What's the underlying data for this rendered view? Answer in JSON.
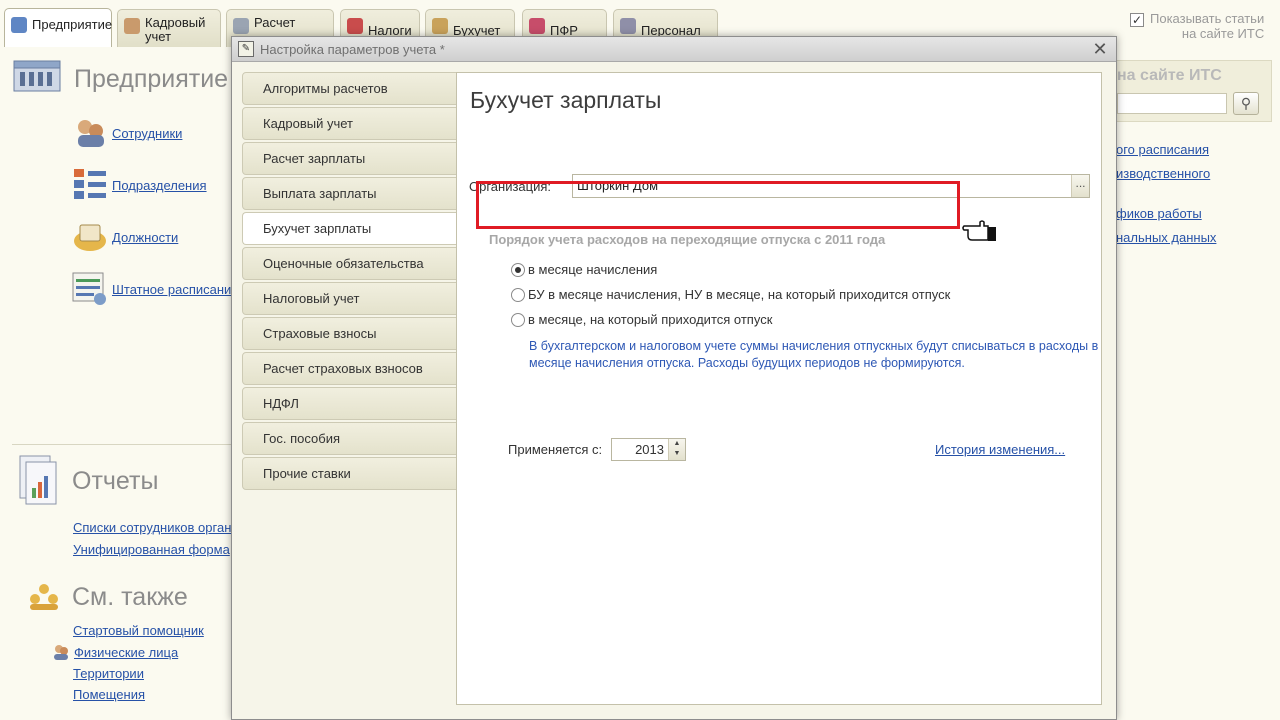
{
  "top_tabs": [
    {
      "label": "Предприятие",
      "icon": "enterprise-icon",
      "active": true
    },
    {
      "label": "Кадровый\nучет",
      "icon": "people-icon",
      "active": false
    },
    {
      "label": "Расчет\n",
      "icon": "calc-icon",
      "active": false
    },
    {
      "label": "Налоги",
      "icon": "taxes-icon",
      "active": false
    },
    {
      "label": "Бухучет",
      "icon": "accounting-icon",
      "active": false
    },
    {
      "label": "ПФР",
      "icon": "pension-fund-icon",
      "active": false
    },
    {
      "label": "Персонал",
      "icon": "personnel-icon",
      "active": false
    }
  ],
  "show_its": {
    "label": "Показывать статьи\nна сайте ИТС",
    "checked": true
  },
  "left_panel": {
    "enterprise_title": "Предприятие",
    "enterprise_links": [
      "Сотрудники",
      "Подразделения",
      "Должности",
      "Штатное расписание"
    ],
    "reports_title": "Отчеты",
    "reports_links": [
      "Списки сотрудников организаций",
      "Унифицированная форма"
    ],
    "see_also_title": "См. также",
    "see_also_links": [
      "Стартовый помощник",
      "Физические лица",
      "Территории",
      "Помещения"
    ]
  },
  "right_panel": {
    "its_title": "на сайте ИТС",
    "links": [
      "ого расписания",
      "изводственного",
      "фиков работы",
      "нальных данных"
    ]
  },
  "dialog": {
    "title": "Настройка параметров учета *",
    "close_symbol": "✕",
    "nav_items": [
      "Алгоритмы расчетов",
      "Кадровый учет",
      "Расчет зарплаты",
      "Выплата зарплаты",
      "Бухучет зарплаты",
      "Оценочные обязательства",
      "Налоговый учет",
      "Страховые взносы",
      "Расчет страховых взносов",
      "НДФЛ",
      "Гос. пособия",
      "Прочие ставки"
    ],
    "active_nav": "Бухучет зарплаты",
    "content": {
      "title": "Бухучет зарплаты",
      "org_label": "Организация:",
      "org_value": "Шторкин Дом",
      "org_button": "...",
      "group_title": "Порядок учета расходов на переходящие отпуска с 2011 года",
      "radio_options": [
        {
          "label": "в месяце начисления",
          "selected": true
        },
        {
          "label": "БУ в месяце начисления, НУ в месяце, на который приходится отпуск",
          "selected": false
        },
        {
          "label": "в месяце, на который приходится отпуск",
          "selected": false
        }
      ],
      "note": "В бухгалтерском и налоговом учете суммы начисления отпускных будут списываться в расходы в месяце начисления отпуска. Расходы будущих периодов не формируются.",
      "applies_label": "Применяется с:",
      "year_value": "2013",
      "history_link": "История изменения..."
    }
  },
  "colors": {
    "highlight": "#e01b24",
    "link": "#2651a7",
    "note": "#2e58b5"
  }
}
